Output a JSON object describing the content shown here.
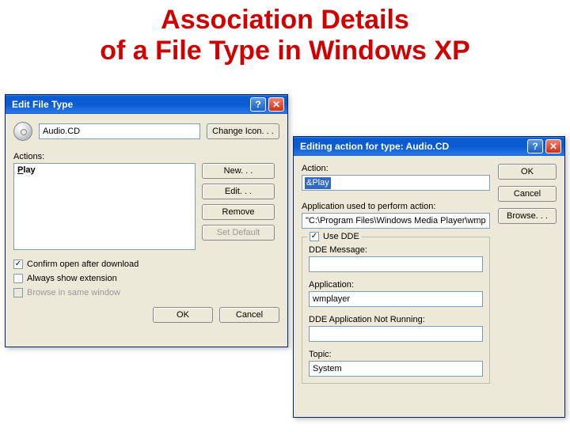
{
  "slide": {
    "title_line1": "Association Details",
    "title_line2": "of a File Type in Windows XP"
  },
  "dialog1": {
    "title": "Edit File Type",
    "file_type_name": "Audio.CD",
    "change_icon_btn": "Change Icon. . .",
    "actions_label": "Actions:",
    "actions": [
      "Play"
    ],
    "new_btn": "New. . .",
    "edit_btn": "Edit. . .",
    "remove_btn": "Remove",
    "set_default_btn": "Set Default",
    "confirm_open": "Confirm open after download",
    "always_show_ext": "Always show extension",
    "browse_same": "Browse in same window",
    "ok": "OK",
    "cancel": "Cancel"
  },
  "dialog2": {
    "title": "Editing action for type: Audio.CD",
    "action_label": "Action:",
    "action_value": "&Play",
    "app_used_label": "Application used to perform action:",
    "app_used_value": "\"C:\\Program Files\\Windows Media Player\\wmpl",
    "use_dde": "Use DDE",
    "dde_message_label": "DDE Message:",
    "dde_message_value": "",
    "application_label": "Application:",
    "application_value": "wmplayer",
    "dde_not_running_label": "DDE Application Not Running:",
    "dde_not_running_value": "",
    "topic_label": "Topic:",
    "topic_value": "System",
    "ok": "OK",
    "cancel": "Cancel",
    "browse": "Browse. . ."
  }
}
